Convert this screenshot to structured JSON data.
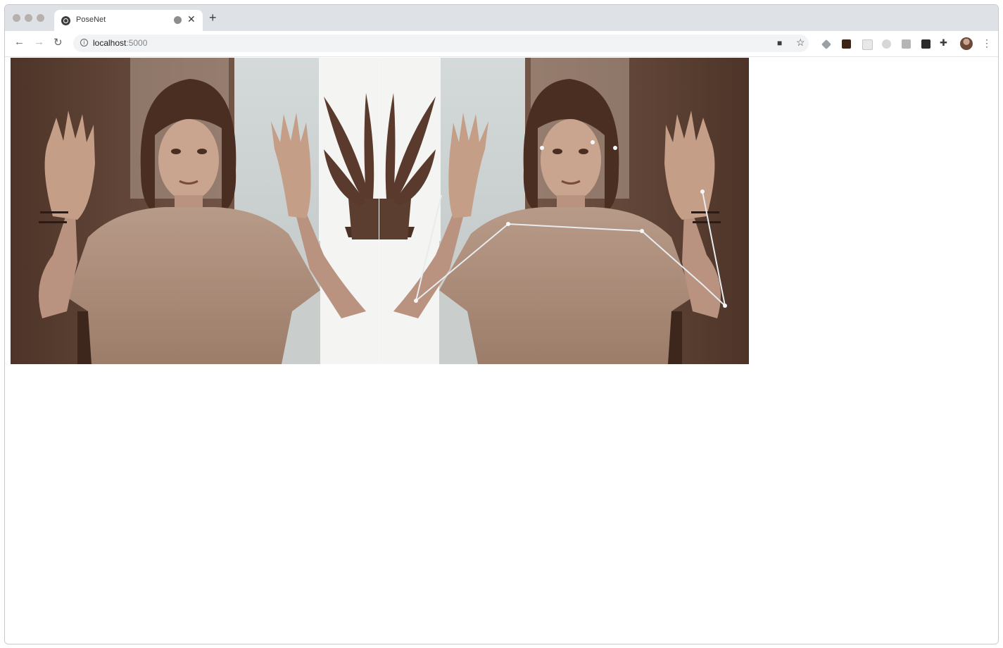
{
  "browser": {
    "tab_title": "PoseNet",
    "url_host": "localhost",
    "url_port": ":5000"
  },
  "icons": {
    "back": "arrow-left-icon",
    "forward": "arrow-right-icon",
    "reload": "reload-icon",
    "info": "info-icon",
    "star": "star-icon",
    "extensions": "puzzle-icon",
    "menu": "more-vert-icon"
  },
  "colors": {
    "tabbar_bg": "#dee1e6",
    "omnibox_bg": "#f1f3f4",
    "pose_stroke": "#e8ecef"
  }
}
